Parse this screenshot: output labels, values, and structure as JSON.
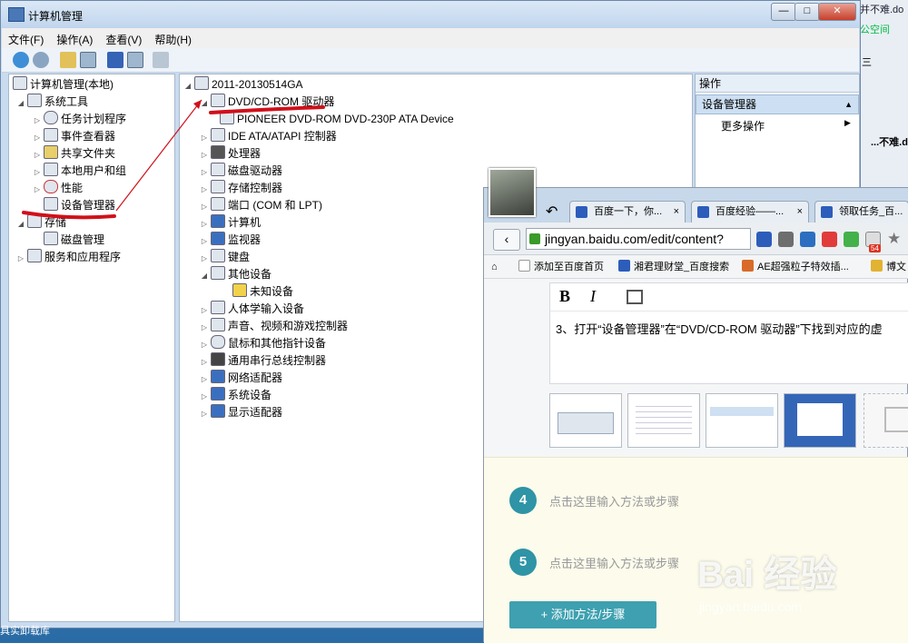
{
  "background_window": {
    "title_fragment": "并不难.do",
    "space_label": "公空间",
    "ruler_mark": "三",
    "doc_fragment": "...不难.do"
  },
  "window": {
    "title": "计算机管理",
    "controls": {
      "minimize": "—",
      "maximize": "□",
      "close": "✕"
    }
  },
  "menu": [
    "文件(F)",
    "操作(A)",
    "查看(V)",
    "帮助(H)"
  ],
  "left_tree": [
    {
      "label": "计算机管理(本地)",
      "level": 0,
      "arrow": ""
    },
    {
      "label": "系统工具",
      "level": 1,
      "arrow": "◢"
    },
    {
      "label": "任务计划程序",
      "level": 2,
      "arrow": "▷"
    },
    {
      "label": "事件查看器",
      "level": 2,
      "arrow": "▷"
    },
    {
      "label": "共享文件夹",
      "level": 2,
      "arrow": "▷"
    },
    {
      "label": "本地用户和组",
      "level": 2,
      "arrow": "▷"
    },
    {
      "label": "性能",
      "level": 2,
      "arrow": "▷"
    },
    {
      "label": "设备管理器",
      "level": 2,
      "arrow": ""
    },
    {
      "label": "存储",
      "level": 1,
      "arrow": "◢"
    },
    {
      "label": "磁盘管理",
      "level": 2,
      "arrow": ""
    },
    {
      "label": "服务和应用程序",
      "level": 1,
      "arrow": "▷"
    }
  ],
  "device_tree": [
    {
      "label": "2011-20130514GA",
      "level": 0,
      "arrow": "◢"
    },
    {
      "label": "DVD/CD-ROM 驱动器",
      "level": 1,
      "arrow": "◢"
    },
    {
      "label": "PIONEER DVD-ROM DVD-230P ATA Device",
      "level": 2,
      "arrow": ""
    },
    {
      "label": "IDE ATA/ATAPI 控制器",
      "level": 1,
      "arrow": "▷"
    },
    {
      "label": "处理器",
      "level": 1,
      "arrow": "▷"
    },
    {
      "label": "磁盘驱动器",
      "level": 1,
      "arrow": "▷"
    },
    {
      "label": "存储控制器",
      "level": 1,
      "arrow": "▷"
    },
    {
      "label": "端口 (COM 和 LPT)",
      "level": 1,
      "arrow": "▷"
    },
    {
      "label": "计算机",
      "level": 1,
      "arrow": "▷"
    },
    {
      "label": "监视器",
      "level": 1,
      "arrow": "▷"
    },
    {
      "label": "键盘",
      "level": 1,
      "arrow": "▷"
    },
    {
      "label": "其他设备",
      "level": 1,
      "arrow": "◢"
    },
    {
      "label": "未知设备",
      "level": 2,
      "arrow": ""
    },
    {
      "label": "人体学输入设备",
      "level": 1,
      "arrow": "▷"
    },
    {
      "label": "声音、视频和游戏控制器",
      "level": 1,
      "arrow": "▷"
    },
    {
      "label": "鼠标和其他指针设备",
      "level": 1,
      "arrow": "▷"
    },
    {
      "label": "通用串行总线控制器",
      "level": 1,
      "arrow": "▷"
    },
    {
      "label": "网络适配器",
      "level": 1,
      "arrow": "▷"
    },
    {
      "label": "系统设备",
      "level": 1,
      "arrow": "▷"
    },
    {
      "label": "显示适配器",
      "level": 1,
      "arrow": "▷"
    }
  ],
  "actions": {
    "header": "操作",
    "selected": "设备管理器",
    "more": "更多操作"
  },
  "browser": {
    "tabs": [
      {
        "label": "百度一下，你..."
      },
      {
        "label": "百度经验——..."
      },
      {
        "label": "领取任务_百..."
      }
    ],
    "tab_close": "×",
    "url": "jingyan.baidu.com/edit/content?",
    "badge": "54",
    "bookmarks": [
      "添加至百度首页",
      "湘君理财堂_百度搜索",
      "AE超强粒子特效插...",
      "博文"
    ],
    "editor": {
      "bold": "B",
      "italic": "I",
      "text": "3、打开“设备管理器”在“DVD/CD-ROM 驱动器”下找到对应的虚"
    },
    "steps": [
      {
        "num": "4",
        "text": "点击这里输入方法或步骤"
      },
      {
        "num": "5",
        "text": "点击这里输入方法或步骤"
      }
    ],
    "add_button": "+ 添加方法/步骤"
  },
  "watermark": {
    "brand": "Bai 经验",
    "url": "jingyan.baidu.com"
  },
  "taskbar_text": "具实卸载库"
}
